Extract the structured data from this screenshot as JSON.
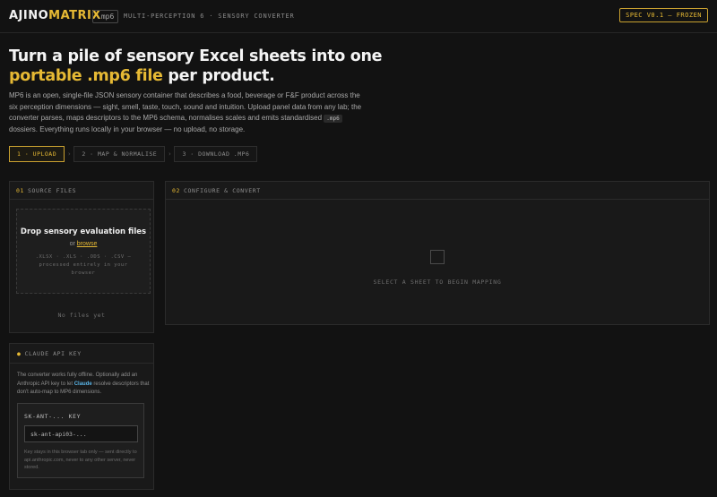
{
  "header": {
    "logo_part1": "AJINO",
    "logo_part2": "MATRIX",
    "ext_badge": ".mp6",
    "tagline": "MULTI-PERCEPTION 6 · SENSORY CONVERTER",
    "spec_badge": "SPEC V0.1 — FROZEN"
  },
  "hero": {
    "title_part1": "Turn a pile of sensory Excel sheets into one ",
    "title_highlight": "portable .mp6 file",
    "title_part2": " per product.",
    "desc_part1": "MP6 is an open, single-file JSON sensory container that describes a food, beverage or F&F product across the six perception dimensions — sight, smell, taste, touch, sound and intuition. Upload panel data from any lab; the converter parses, maps descriptors to the MP6 schema, normalises scales and emits standardised ",
    "desc_chip": ".mp6",
    "desc_part2": " dossiers. Everything runs locally in your browser — no upload, no storage."
  },
  "steps": [
    {
      "label": "1 · UPLOAD"
    },
    {
      "label": "2 · MAP & NORMALISE"
    },
    {
      "label": "3 · DOWNLOAD .MP6"
    }
  ],
  "step_separator": "›",
  "source_panel": {
    "num": "01",
    "title": "SOURCE FILES",
    "drop_title": "Drop sensory evaluation files",
    "drop_or": "or ",
    "drop_link": "browse",
    "drop_formats": ".XLSX · .XLS · .ODS · .CSV — processed entirely in your browser",
    "empty": "No files yet"
  },
  "config_panel": {
    "num": "02",
    "title": "CONFIGURE & CONVERT",
    "empty_msg": "SELECT A SHEET TO BEGIN MAPPING"
  },
  "api_panel": {
    "title": "CLAUDE API KEY",
    "desc_part1": "The converter works fully offline. Optionally add an Anthropic API key to let ",
    "desc_claude": "Claude",
    "desc_part2": " resolve descriptors that don't auto-map to MP6 dimensions.",
    "label": "SK-ANT-... KEY",
    "placeholder": "sk-ant-api03-...",
    "note": "Key stays in this browser tab only — sent directly to api.anthropic.com, never to any other server, never stored."
  },
  "colors": {
    "accent": "#e6b934",
    "background": "#121212",
    "panel": "#191919",
    "link_claude": "#5ab4e6"
  }
}
